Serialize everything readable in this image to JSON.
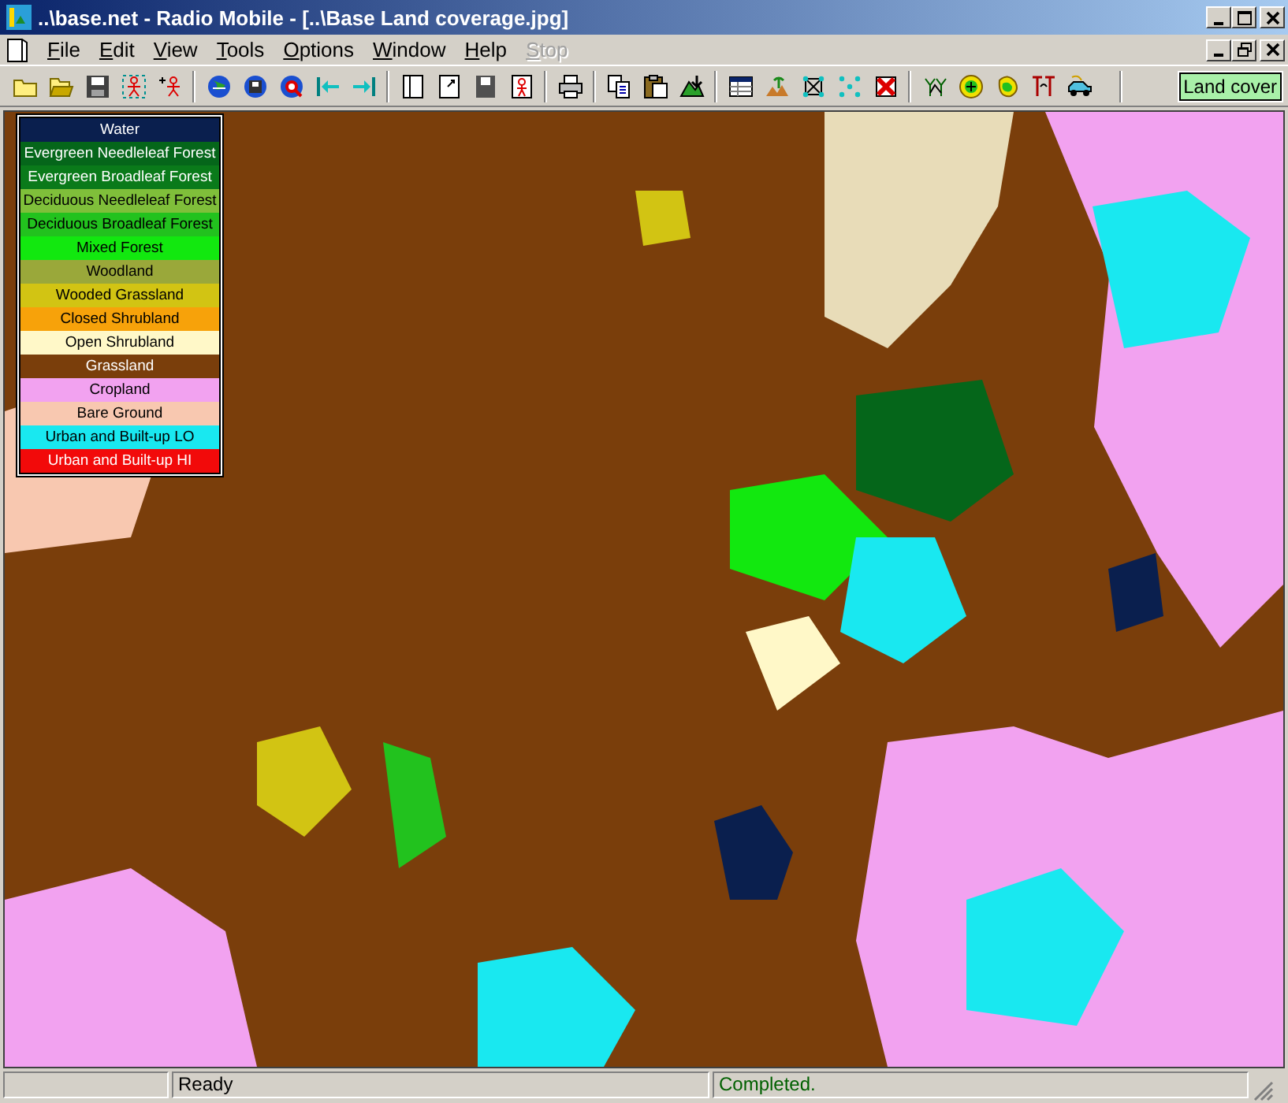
{
  "window": {
    "title": "..\\base.net - Radio Mobile - [..\\Base Land coverage.jpg]"
  },
  "menu": [
    {
      "label": "File",
      "disabled": false
    },
    {
      "label": "Edit",
      "disabled": false
    },
    {
      "label": "View",
      "disabled": false
    },
    {
      "label": "Tools",
      "disabled": false
    },
    {
      "label": "Options",
      "disabled": false
    },
    {
      "label": "Window",
      "disabled": false
    },
    {
      "label": "Help",
      "disabled": false
    },
    {
      "label": "Stop",
      "disabled": true
    }
  ],
  "toolbar": {
    "layer_label": "Land cover"
  },
  "legend": [
    {
      "label": "Water",
      "color": "#0a1f4e"
    },
    {
      "label": "Evergreen Needleleaf Forest",
      "color": "#05661a"
    },
    {
      "label": "Evergreen Broadleaf Forest",
      "color": "#0a7a1a"
    },
    {
      "label": "Deciduous Needleleaf Forest",
      "color": "#7fbf3a"
    },
    {
      "label": "Deciduous Broadleaf Forest",
      "color": "#22c21e"
    },
    {
      "label": "Mixed Forest",
      "color": "#12e80f"
    },
    {
      "label": "Woodland",
      "color": "#9aa83a"
    },
    {
      "label": "Wooded Grassland",
      "color": "#d2c413"
    },
    {
      "label": "Closed Shrubland",
      "color": "#f7a20a"
    },
    {
      "label": "Open Shrubland",
      "color": "#fff8c8"
    },
    {
      "label": "Grassland",
      "color": "#7a3e0b"
    },
    {
      "label": "Cropland",
      "color": "#f2a2f0"
    },
    {
      "label": "Bare Ground",
      "color": "#f8c8b0"
    },
    {
      "label": "Urban and Built-up LO",
      "color": "#19e8f0"
    },
    {
      "label": "Urban and Built-up HI",
      "color": "#f20a0a"
    }
  ],
  "status_bar": [
    {
      "text": "Ready"
    },
    {
      "text": "Completed."
    }
  ]
}
